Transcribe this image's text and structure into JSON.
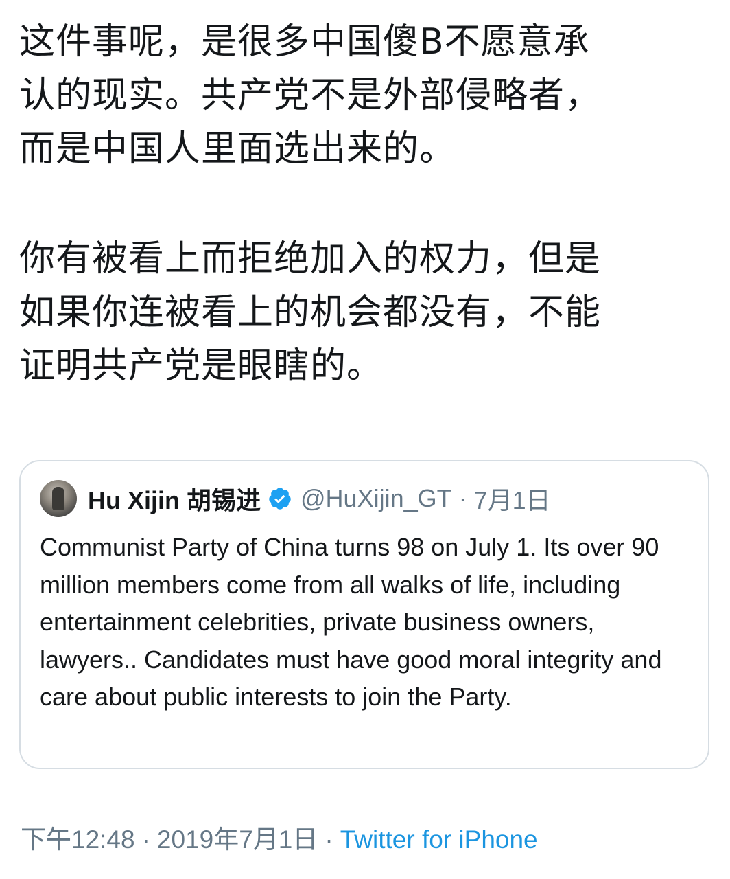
{
  "tweet": {
    "paragraphs": [
      "这件事呢，是很多中国傻B不愿意承\n认的现实。共产党不是外部侵略者，\n而是中国人里面选出来的。",
      "你有被看上而拒绝加入的权力，但是\n如果你连被看上的机会都没有，不能\n证明共产党是眼瞎的。"
    ]
  },
  "quoted_tweet": {
    "author_name": "Hu Xijin 胡锡进",
    "verified_icon": "verified-badge-icon",
    "handle": "@HuXijin_GT",
    "separator": "·",
    "date": "7月1日",
    "text": "Communist Party of China turns 98 on July 1. Its over 90 million members come from all walks of life, including entertainment celebrities, private business owners, lawyers.. Candidates must have good moral integrity and care about public interests to join the Party."
  },
  "meta": {
    "time": "下午12:48",
    "separator": "·",
    "date": "2019年7月1日",
    "source": "Twitter for iPhone"
  },
  "colors": {
    "text": "#14171a",
    "secondary": "#657786",
    "link": "#1b95e0",
    "border": "#d6dde3"
  }
}
